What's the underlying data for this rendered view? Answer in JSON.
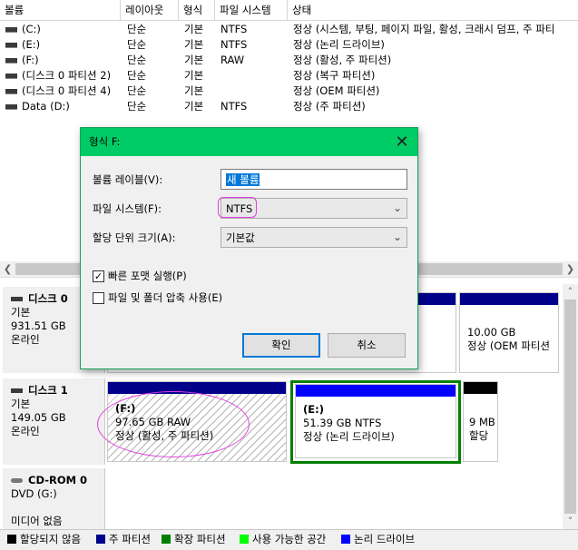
{
  "volume_list": {
    "headers": [
      "볼륨",
      "레이아웃",
      "형식",
      "파일 시스템",
      "상태"
    ],
    "rows": [
      {
        "volume": "(C:)",
        "layout": "단순",
        "type": "기본",
        "fs": "NTFS",
        "status": "정상 (시스템, 부팅, 페이지 파일, 활성, 크래시 덤프, 주 파티"
      },
      {
        "volume": "(E:)",
        "layout": "단순",
        "type": "기본",
        "fs": "NTFS",
        "status": "정상 (논리 드라이브)"
      },
      {
        "volume": "(F:)",
        "layout": "단순",
        "type": "기본",
        "fs": "RAW",
        "status": "정상 (활성, 주 파티션)"
      },
      {
        "volume": "(디스크 0 파티션 2)",
        "layout": "단순",
        "type": "기본",
        "fs": "",
        "status": "정상 (복구 파티션)"
      },
      {
        "volume": "(디스크 0 파티션 4)",
        "layout": "단순",
        "type": "기본",
        "fs": "",
        "status": "정상 (OEM 파티션)"
      },
      {
        "volume": "Data (D:)",
        "layout": "단순",
        "type": "기본",
        "fs": "NTFS",
        "status": "정상 (주 파티션)"
      }
    ]
  },
  "disks": {
    "disk0": {
      "name": "디스크 0",
      "kind": "기본",
      "size": "931.51 GB",
      "state": "온라인",
      "oem_partition": {
        "size": "10.00 GB",
        "status": "정상 (OEM 파티션"
      }
    },
    "disk1": {
      "name": "디스크 1",
      "kind": "기본",
      "size": "149.05 GB",
      "state": "온라인",
      "partitions": [
        {
          "letter": "(F:)",
          "size": "97.65 GB RAW",
          "status": "정상 (활성, 주 파티션)"
        },
        {
          "letter": "(E:)",
          "size": "51.39 GB NTFS",
          "status": "정상 (논리 드라이브)"
        },
        {
          "letter": "",
          "size": "9 MB",
          "status": "할당"
        }
      ]
    },
    "cdrom0": {
      "name": "CD-ROM 0",
      "kind": "DVD (G:)",
      "media": "미디어 없음"
    }
  },
  "legend": [
    {
      "label": "할당되지 않음",
      "color": "#000000"
    },
    {
      "label": "주 파티션",
      "color": "#00008b"
    },
    {
      "label": "확장 파티션",
      "color": "#008000"
    },
    {
      "label": "사용 가능한 공간",
      "color": "#00ff00"
    },
    {
      "label": "논리 드라이브",
      "color": "#0000ff"
    }
  ],
  "dialog": {
    "title": "형식 F:",
    "volume_label_label": "볼륨 레이블(V):",
    "volume_label_value": "새 볼륨",
    "fs_label": "파일 시스템(F):",
    "fs_value": "NTFS",
    "alloc_label": "할당 단위 크기(A):",
    "alloc_value": "기본값",
    "quick_format_label": "빠른 포맷 실행(P)",
    "quick_format_checked": true,
    "compress_label": "파일 및 폴더 압축 사용(E)",
    "compress_checked": false,
    "ok_label": "확인",
    "cancel_label": "취소"
  },
  "colors": {
    "primary": "#00008b",
    "logical": "#0000ff",
    "extended_border": "#008000",
    "unallocated": "#000000",
    "dialog_title": "#00cc66",
    "highlight_circle": "#e040e0"
  },
  "icons": {
    "close": "close-icon",
    "drive": "drive-icon",
    "cdrom": "cdrom-icon",
    "dropdown": "chevron-down-icon"
  }
}
